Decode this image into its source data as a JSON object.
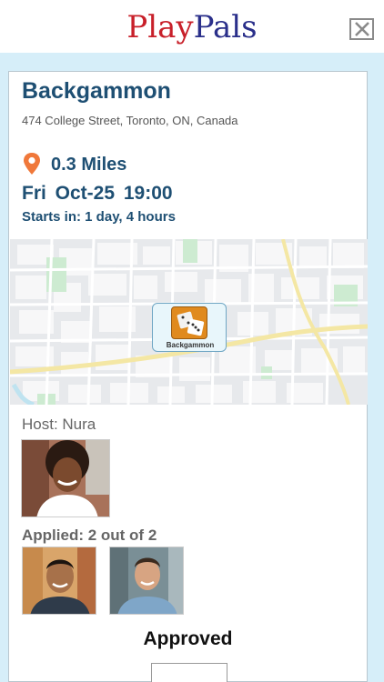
{
  "app": {
    "logo_part1": "Play",
    "logo_part2": "Pals",
    "logo_colors": [
      "#c8202a",
      "#2a2f8a"
    ]
  },
  "event": {
    "title": "Backgammon",
    "address": "474 College Street, Toronto, ON, Canada",
    "distance": "0.3 Miles",
    "datetime": "Fri  Oct-25  19:00",
    "starts_in": "Starts in:  1 day, 4 hours"
  },
  "map": {
    "marker_label": "Backgammon",
    "marker_icon": "backgammon-dice-icon"
  },
  "host": {
    "label": "Host: Nura",
    "avatar_icon": "host-avatar"
  },
  "applicants": {
    "label": "Applied: 2 out of 2",
    "count": 2,
    "total": 2
  },
  "status": {
    "text": "Approved"
  },
  "icons": {
    "close": "close-icon",
    "pin": "location-pin-icon"
  },
  "colors": {
    "accent": "#1e4f73",
    "pin": "#f0783a",
    "background": "#d6eef9"
  }
}
